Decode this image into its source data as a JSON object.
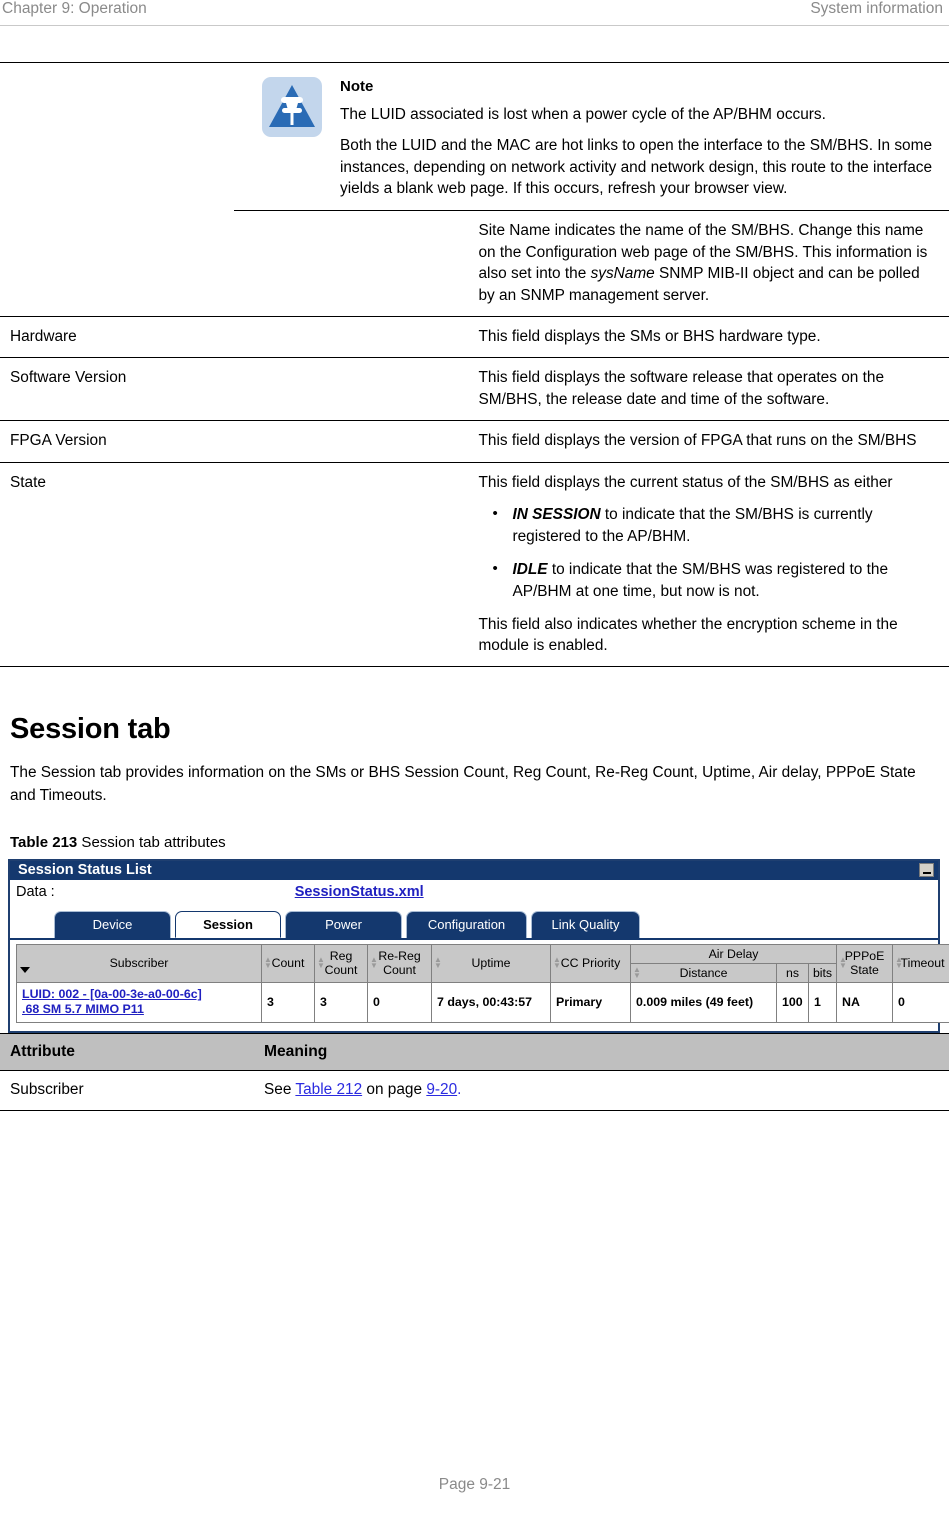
{
  "header": {
    "left": "Chapter 9:  Operation",
    "right": "System information"
  },
  "note": {
    "icon": "note-pushpin-triangle-icon",
    "title": "Note",
    "paragraphs": [
      "The LUID associated is lost when a power cycle of the AP/BHM occurs.",
      "Both the LUID and the MAC are hot links to open the interface to the SM/BHS. In some instances, depending on network activity and network design, this route to the interface yields a blank web page. If this occurs, refresh your browser view."
    ]
  },
  "site_name_row": {
    "text_1": "Site Name indicates the name of the SM/BHS. Change this name on the Configuration web page of the SM/BHS. This information is also set into the ",
    "italic": "sysName",
    "text_2": " SNMP MIB-II object and can be polled by an SNMP management server."
  },
  "attribute_rows": [
    {
      "attribute": "Hardware",
      "meaning": "This field displays the SMs or BHS hardware type."
    },
    {
      "attribute": "Software Version",
      "meaning": "This field displays the software release that operates on the SM/BHS, the release date and time of the software."
    },
    {
      "attribute": "FPGA Version",
      "meaning": "This field displays the version of FPGA that runs on the SM/BHS"
    }
  ],
  "state_row": {
    "attribute": "State",
    "intro": "This field displays the current status of the SM/BHS as either",
    "bullets": [
      {
        "bold": "IN SESSION",
        "rest": " to indicate that the SM/BHS is currently registered to the AP/BHM."
      },
      {
        "bold": "IDLE",
        "rest": " to indicate that the SM/BHS was registered to the AP/BHM at one time, but now is not."
      }
    ],
    "outro": "This field also indicates whether the encryption scheme in the module is enabled."
  },
  "session_section": {
    "title": "Session tab",
    "body": "The Session tab provides information on the SMs or BHS Session Count, Reg Count, Re-Reg Count, Uptime, Air delay, PPPoE State and Timeouts.",
    "caption_number": "Table 213",
    "caption_text": " Session tab attributes"
  },
  "screenshot": {
    "window_title": "Session Status List",
    "minimize_icon": "minimize-icon",
    "data_label": "Data :",
    "data_link": "SessionStatus.xml",
    "tabs": [
      {
        "label": "Device",
        "active": false
      },
      {
        "label": "Session",
        "active": true
      },
      {
        "label": "Power",
        "active": false
      },
      {
        "label": "Configuration",
        "active": false
      },
      {
        "label": "Link Quality",
        "active": false
      }
    ],
    "grid": {
      "group_header": "Air Delay",
      "columns": [
        "Subscriber",
        "Count",
        "Reg Count",
        "Re-Reg Count",
        "Uptime",
        "CC Priority",
        "Distance",
        "ns",
        "bits",
        "PPPoE State",
        "Timeout"
      ],
      "rows": [
        {
          "subscriber_line1": "LUID: 002 - [0a-00-3e-a0-00-6c]",
          "subscriber_line2": ".68 SM 5.7 MIMO P11",
          "count": "3",
          "reg_count": "3",
          "re_reg_count": "0",
          "uptime": "7 days, 00:43:57",
          "cc_priority": "Primary",
          "distance": "0.009 miles (49 feet)",
          "ns": "100",
          "bits": "1",
          "pppoe_state": "NA",
          "timeout": "0"
        }
      ]
    }
  },
  "meaning_table": {
    "col_attribute": "Attribute",
    "col_meaning": "Meaning",
    "rows": [
      {
        "attribute": "Subscriber",
        "meaning_pre": "See ",
        "meaning_xref1": "Table 212",
        "meaning_mid": " on page ",
        "meaning_xref2": "9-20",
        "meaning_post": "."
      }
    ]
  },
  "footer": {
    "page": "Page 9-21"
  },
  "colors": {
    "ui_blue": "#14386e",
    "link_blue": "#2020c0",
    "header_gray": "#bfbfbf",
    "grid_header_gray": "#c8c8c8",
    "note_icon_bg": "#c3d6ec",
    "xref_blue": "#2b2be0"
  }
}
